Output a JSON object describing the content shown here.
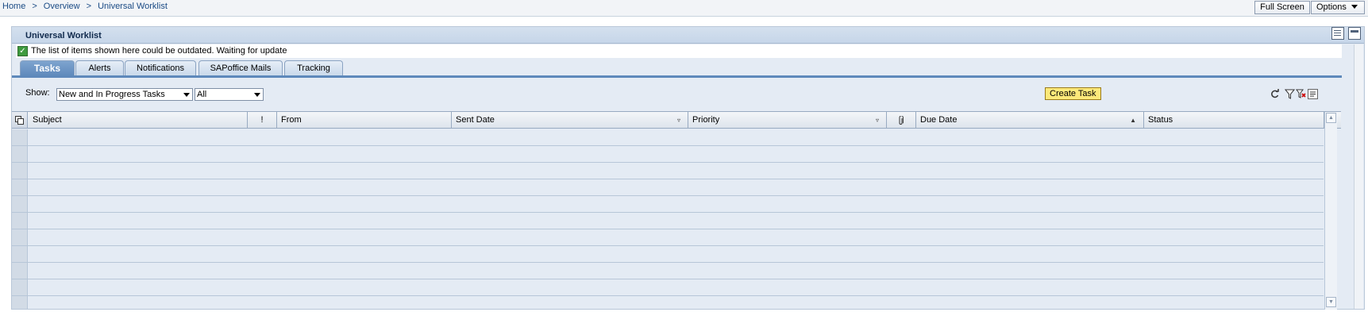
{
  "breadcrumb": {
    "items": [
      "Home",
      "Overview",
      "Universal Worklist"
    ],
    "separator": ">"
  },
  "top_buttons": {
    "full_screen": "Full Screen",
    "options": "Options"
  },
  "panel": {
    "title": "Universal Worklist",
    "notice": "The list of items shown here could be outdated. Waiting for update"
  },
  "tabs": [
    {
      "label": "Tasks",
      "active": true
    },
    {
      "label": "Alerts",
      "active": false
    },
    {
      "label": "Notifications",
      "active": false
    },
    {
      "label": "SAPoffice Mails",
      "active": false
    },
    {
      "label": "Tracking",
      "active": false
    }
  ],
  "toolbar": {
    "show_label": "Show:",
    "filter_select": "New and In Progress Tasks",
    "scope_select": "All",
    "create_task": "Create Task",
    "icons": [
      "refresh-icon",
      "filter-icon",
      "remove-filter-icon",
      "settings-icon"
    ]
  },
  "table": {
    "columns": [
      {
        "label": "Subject",
        "sort": ""
      },
      {
        "label": "!",
        "sort": ""
      },
      {
        "label": "From",
        "sort": ""
      },
      {
        "label": "Sent Date",
        "sort": "filter"
      },
      {
        "label": "Priority",
        "sort": "filter"
      },
      {
        "label": "",
        "sort": "attachment"
      },
      {
        "label": "Due Date",
        "sort": "ascending"
      },
      {
        "label": "Status",
        "sort": ""
      }
    ],
    "rows": []
  },
  "colors": {
    "active_tab": "#5e89bb",
    "panel_bg": "#e4ebf4",
    "create_button": "#fde97a"
  }
}
